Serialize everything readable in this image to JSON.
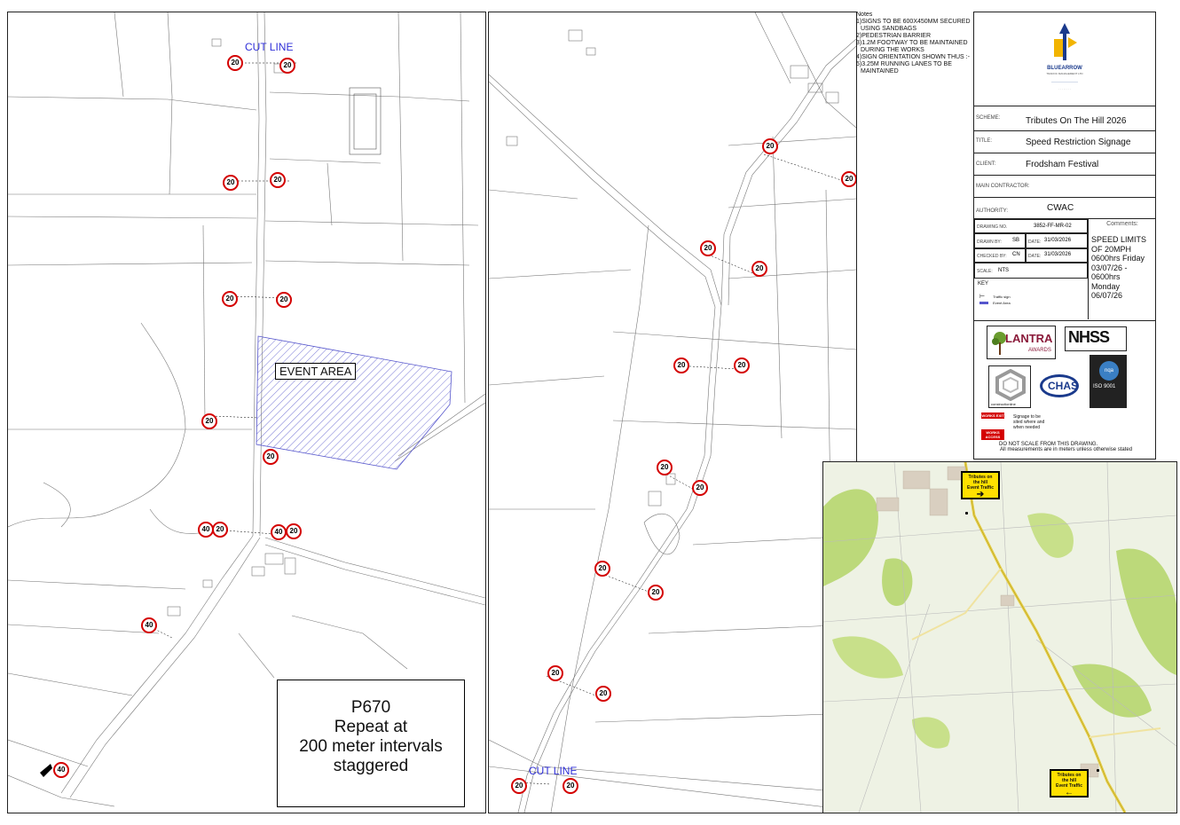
{
  "left_map": {
    "cut_line_label": "CUT LINE",
    "event_area_label": "EVENT AREA",
    "p670_box": [
      "P670",
      "Repeat at",
      "200 meter intervals",
      "staggered"
    ]
  },
  "right_map": {
    "cut_line_label": "CUT LINE"
  },
  "notes": {
    "title": "Notes",
    "items": [
      "1)SIGNS TO BE 600X450MM SECURED",
      "USING SANDBAGS",
      "2)PEDESTRIAN BARRIER",
      "3)1.2M FOOTWAY TO BE MAINTAINED",
      "DURING THE WORKS",
      "4)SIGN ORIENTATION SHOWN THUS :-",
      "5)3.25M RUNNING LANES TO BE",
      "MAINTAINED"
    ]
  },
  "title_block": {
    "brand": "BLUEARROW",
    "brand_sub": "TRAFFIC MANAGEMENT LTD",
    "scheme_label": "SCHEME:",
    "scheme": "Tributes On The Hill 2026",
    "title_label": "TITLE:",
    "title": "Speed Restriction Signage",
    "client_label": "CLIENT:",
    "client": "Frodsham Festival",
    "contractor_label": "MAIN CONTRACTOR:",
    "authority_label": "AUTHORITY:",
    "authority": "CWAC",
    "drawing_no_label": "DRAWING NO.",
    "drawing_no": "3852-FF-MR-02",
    "drawn_by_label": "DRAWN BY:",
    "drawn_by": "SB",
    "date1_label": "DATE:",
    "date1": "31/03/2026",
    "checked_by_label": "CHECKED BY:",
    "checked_by": "CN",
    "date2_label": "DATE:",
    "date2": "31/03/2026",
    "scale_label": "SCALE:",
    "scale": "NTS",
    "comments_head": "Comments:",
    "comments": [
      "SPEED LIMITS",
      "OF 20MPH",
      "0600hrs Friday",
      "03/07/26  -",
      "0600hrs",
      "Monday",
      "06/07/26"
    ],
    "key_label": "KEY",
    "key_items": [
      "Traffic sign",
      "Event Area"
    ],
    "badges": [
      "LANTRA",
      "AWARDS",
      "NHSS",
      "ISO 9001",
      "CHAS",
      "constructionline"
    ],
    "works_signs": [
      "WORKS EXIT",
      "WORKS ACCESS"
    ],
    "sign_note": [
      "Signage to be",
      "sited where and",
      "when needed"
    ],
    "footer1": "DO NOT SCALE FROM THIS DRAWING.",
    "footer2": "All measurements are in meters unless otherwise stated"
  },
  "inset_map": {
    "sign_top": [
      "Tributes on",
      "the hill",
      "Event Traffic"
    ],
    "sign_bottom": [
      "Tributes on",
      "the hill",
      "Event Traffic"
    ]
  },
  "colors": {
    "sign_ring": "#d40000",
    "cut_line": "#2f2fd8",
    "event_hatch": "#5555cc",
    "tot_sign": "#ffe000",
    "inset_road": "#e6cf4a",
    "inset_green": "#bcd97a"
  }
}
